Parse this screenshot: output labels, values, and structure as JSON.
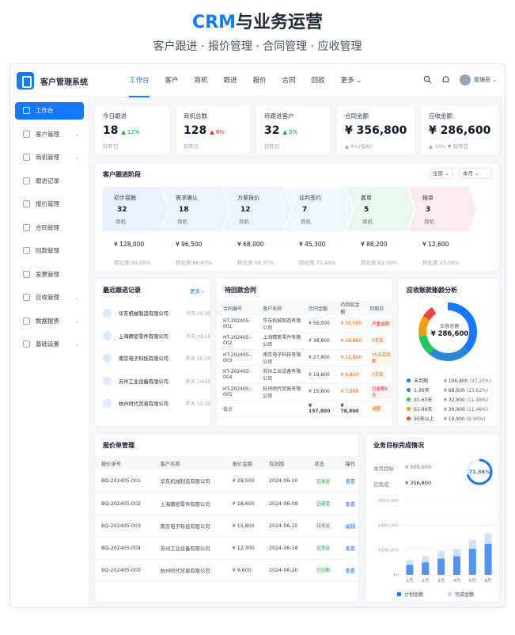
{
  "hero": {
    "title_prefix": "CRM",
    "title_rest": "与业务运营",
    "subtitle": "客户跟进 · 报价管理 · 合同管理 · 应收管理"
  },
  "app": {
    "name": "客户管理系统"
  },
  "nav": [
    "工作台",
    "客户",
    "商机",
    "跟进",
    "报价",
    "合同",
    "回款",
    "更多 ⌄"
  ],
  "user": {
    "name": "管理员 ⌄"
  },
  "sidebar": [
    "工作台",
    "客户管理",
    "商机管理",
    "跟进记录",
    "报价管理",
    "合同管理",
    "回款管理",
    "发票管理",
    "应收管理",
    "数据报表",
    "基础设置"
  ],
  "kpis": [
    {
      "title": "今日跟进",
      "value": "18",
      "delta": "▲ 12%",
      "dir": "up",
      "sub": "较昨日"
    },
    {
      "title": "商机总数",
      "value": "128",
      "delta": "▲ 8%",
      "dir": "down",
      "sub": "较昨日"
    },
    {
      "title": "待跟进客户",
      "value": "32",
      "delta": "▲ 5%",
      "dir": "up",
      "sub": "较昨日"
    },
    {
      "title": "合同金额",
      "value": "¥ 356,800",
      "delta": "",
      "dir": "up",
      "sub": "▲ 8%(指标)"
    },
    {
      "title": "应收金额",
      "value": "¥ 286,600",
      "delta": "",
      "dir": "down",
      "sub": "▲ 10%  ▼ 较昨日"
    }
  ],
  "stages_card": {
    "title": "客户跟进阶段",
    "filter1": "全部 ⌄",
    "filter2": "本月 ⌄"
  },
  "stages": [
    {
      "name": "初步接触",
      "count": "32",
      "unit": "商机",
      "amount": "¥ 128,000",
      "rate": "转化率 56.25%"
    },
    {
      "name": "需求确认",
      "count": "18",
      "unit": "商机",
      "amount": "¥ 96,500",
      "rate": "转化率 66.67%"
    },
    {
      "name": "方案报价",
      "count": "12",
      "unit": "商机",
      "amount": "¥ 68,000",
      "rate": "转化率 58.37%"
    },
    {
      "name": "谈判签约",
      "count": "7",
      "unit": "商机",
      "amount": "¥ 45,300",
      "rate": "转化率 71.43%"
    },
    {
      "name": "赢单",
      "count": "5",
      "unit": "商机",
      "amount": "¥ 88,200",
      "rate": "转化率 62.50%"
    },
    {
      "name": "输单",
      "count": "3",
      "unit": "商机",
      "amount": "¥ 12,600",
      "rate": "转化率 23.08%"
    }
  ],
  "recent": {
    "title": "最近跟进记录",
    "more": "更多 ›",
    "items": [
      {
        "name": "华东机械制造有限公司",
        "time": "今天 10:30"
      },
      {
        "name": "上海精密零件有限公司",
        "time": "今天 09:15"
      },
      {
        "name": "南京电子科技有限公司",
        "time": "昨天 16:20"
      },
      {
        "name": "苏州工业设备有限公司",
        "time": "昨天 14:35"
      },
      {
        "name": "杭州时代贸易有限公司",
        "time": "昨天 11:20"
      }
    ]
  },
  "contracts": {
    "title": "待回款合同",
    "headers": [
      "合同编号",
      "客户名称",
      "合同金额",
      "待回款金额",
      "到期日"
    ],
    "rows": [
      {
        "no": "HT-202405-001",
        "client": "华东机械制造有限公司",
        "amount": "¥ 56,000",
        "due_amt": "¥ 30,000",
        "status": "严重逾期",
        "tone": "red"
      },
      {
        "no": "HT-202405-002",
        "client": "上海精密零件有限公司",
        "amount": "¥ 38,800",
        "due_amt": "¥ 18,800",
        "status": "7天后",
        "tone": "orange"
      },
      {
        "no": "HT-202405-003",
        "client": "南京电子科技有限公司",
        "amount": "¥ 27,800",
        "due_amt": "¥ 12,800",
        "status": "15天后到期",
        "tone": "orange"
      },
      {
        "no": "HT-202405-004",
        "client": "苏州工业设备有限公司",
        "amount": "¥ 19,800",
        "due_amt": "¥ 9,800",
        "status": "7天后",
        "tone": "orange"
      },
      {
        "no": "HT-202405-005",
        "client": "杭州时代贸易有限公司",
        "amount": "¥ 15,600",
        "due_amt": "¥ 7,600",
        "status": "已逾期5天",
        "tone": "red"
      }
    ],
    "total_label": "合计",
    "total_amount": "¥ 157,800",
    "total_due": "¥ 78,800",
    "total_tag": "逾期"
  },
  "receivable": {
    "title": "应收账款账龄分析",
    "center_label": "应收总额",
    "center_value": "¥ 286,600",
    "buckets": [
      {
        "name": "未到期",
        "amount": "¥ 106,800",
        "pct": "(37.25%)",
        "ratio": 0.3725,
        "color": "#1677ff"
      },
      {
        "name": "1-30天",
        "amount": "¥ 68,600",
        "pct": "(23.62%)",
        "ratio": 0.2362,
        "color": "#2a87d8"
      },
      {
        "name": "31-60天",
        "amount": "¥ 32,900",
        "pct": "(11.48%)",
        "ratio": 0.1148,
        "color": "#22c55e"
      },
      {
        "name": "61-90天",
        "amount": "¥ 30,900",
        "pct": "(11.48%)",
        "ratio": 0.1148,
        "color": "#f59e0b"
      },
      {
        "name": "90天以上",
        "amount": "¥ 19,900",
        "pct": "(6.95%)",
        "ratio": 0.0695,
        "color": "#ef4444"
      }
    ]
  },
  "quotes": {
    "title": "报价单管理",
    "headers": [
      "报价单号",
      "客户名称",
      "报价金额",
      "有效期",
      "状态",
      "操作"
    ],
    "rows": [
      {
        "no": "BQ-202405-001",
        "client": "华东机械制造有限公司",
        "amount": "¥ 28,500",
        "valid": "2024-06-10",
        "status": "已发送",
        "tone": "green",
        "op": "查看"
      },
      {
        "no": "BQ-202405-002",
        "client": "上海精密零件有限公司",
        "amount": "¥ 18,600",
        "valid": "2024-06-08",
        "status": "已接受",
        "tone": "green",
        "op": "查看"
      },
      {
        "no": "BQ-202405-003",
        "client": "南京电子科技有限公司",
        "amount": "¥ 15,800",
        "valid": "2024-06-15",
        "status": "待发送",
        "tone": "gray",
        "op": "编辑"
      },
      {
        "no": "BQ-202405-004",
        "client": "苏州工业设备有限公司",
        "amount": "¥ 12,300",
        "valid": "2024-06-18",
        "status": "已发送",
        "tone": "green",
        "op": "查看"
      },
      {
        "no": "BQ-202405-005",
        "client": "杭州时代贸易有限公司",
        "amount": "¥ 9,600",
        "valid": "2024-06-20",
        "status": "已过期",
        "tone": "green",
        "op": "查看"
      }
    ]
  },
  "goal": {
    "title": "业务目标完成情况",
    "target_label": "本月目标",
    "target_value": "¥ 500,000",
    "done_label": "已完成",
    "done_value": "¥ 356,800",
    "pct_label": "71.36%",
    "pct": 0.7136
  },
  "chart_data": {
    "type": "bar",
    "categories": [
      "1月",
      "2月",
      "3月",
      "4月",
      "5月",
      "6月"
    ],
    "series": [
      {
        "name": "计划金额",
        "values": [
          120000,
          150000,
          190000,
          210000,
          280000,
          330000
        ],
        "color": "#1677ff"
      },
      {
        "name": "完成金额",
        "values": [
          80000,
          100000,
          130000,
          150000,
          210000,
          250000
        ],
        "color": "#bfdbfe"
      }
    ],
    "yticks": [
      "¥600,000",
      "¥400,000",
      "¥200,000",
      "¥0"
    ],
    "ylim": [
      0,
      600000
    ]
  }
}
